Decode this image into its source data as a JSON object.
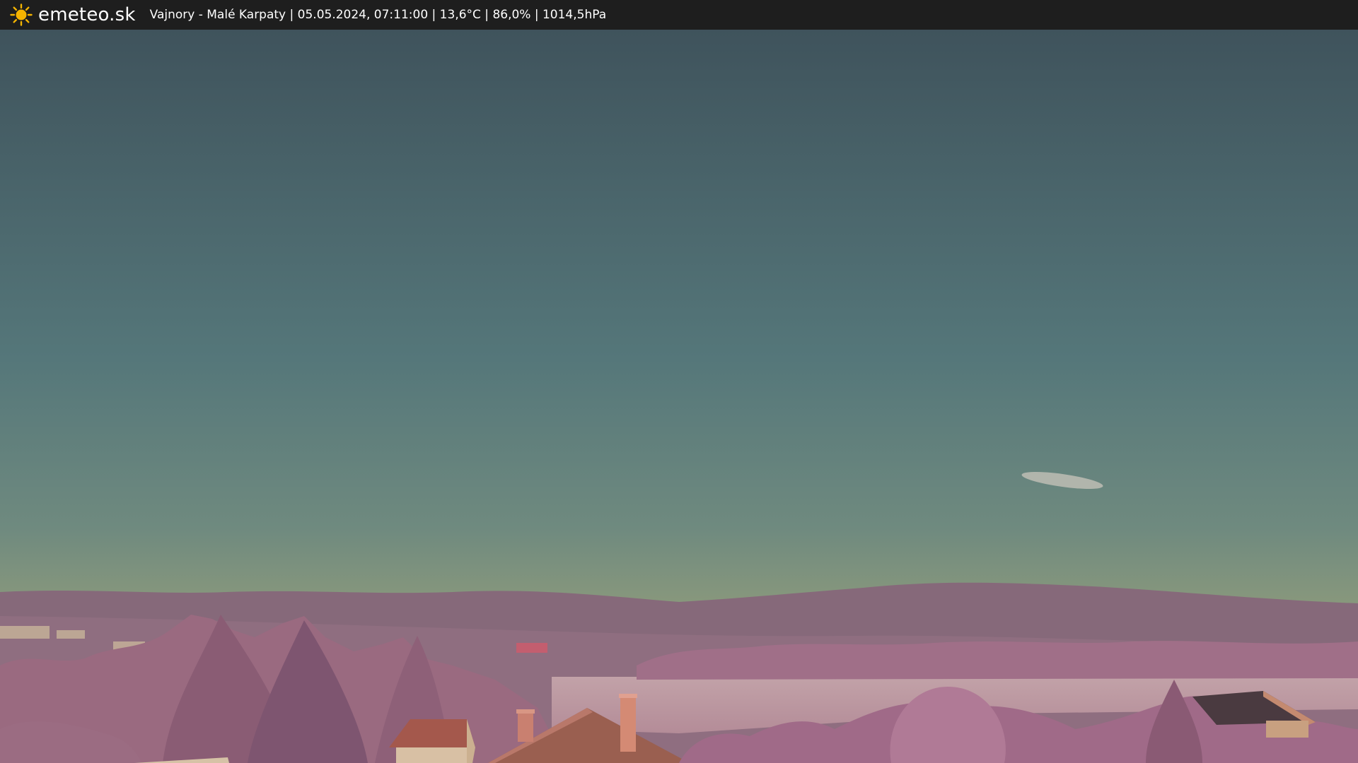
{
  "header": {
    "brand": "emeteo.sk",
    "caption": "Vajnory - Malé Karpaty | 05.05.2024, 07:11:00 | 13,6°C | 86,0% | 1014,5hPa",
    "logo_icon": "sun-icon"
  },
  "colors": {
    "sky_top": "#3f545c",
    "sky_mid": "#57787a",
    "sky_horizon": "#8a9a7e",
    "hills": "#8a6878",
    "foliage": "#b07a94",
    "roof": "#b0705a",
    "bar_bg": "#1e1e1e",
    "logo": "#f5b400"
  }
}
